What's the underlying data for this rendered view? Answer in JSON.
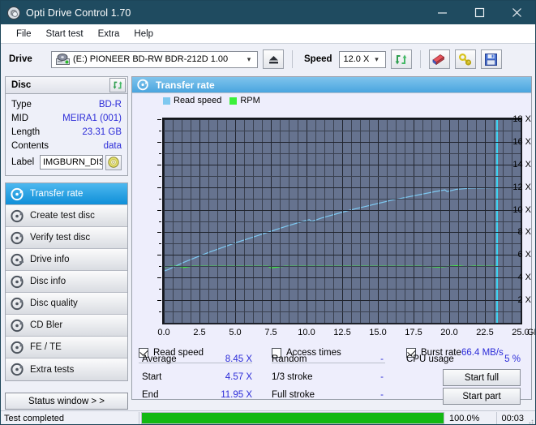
{
  "window": {
    "title": "Opti Drive Control 1.70",
    "icon": "disc-icon",
    "minimize": "–",
    "maximize": "□",
    "close": "✕"
  },
  "menu": [
    {
      "label": "File"
    },
    {
      "label": "Start test"
    },
    {
      "label": "Extra"
    },
    {
      "label": "Help"
    }
  ],
  "toolbar": {
    "drive_label": "Drive",
    "drive_value": "(E:)  PIONEER BD-RW  BDR-212D 1.00",
    "eject_icon": "eject-icon",
    "speed_label": "Speed",
    "speed_value": "12.0 X",
    "refresh_icon": "refresh-icon",
    "erase_icon": "eraser-icon",
    "key_icon": "key-icon",
    "save_icon": "save-icon"
  },
  "disc": {
    "header": "Disc",
    "refresh_icon": "refresh-icon",
    "rows": [
      {
        "key": "Type",
        "value": "BD-R"
      },
      {
        "key": "MID",
        "value": "MEIRA1 (001)"
      },
      {
        "key": "Length",
        "value": "23.31 GB"
      },
      {
        "key": "Contents",
        "value": "data"
      }
    ],
    "label_key": "Label",
    "label_value": "IMGBURN_DIS",
    "label_btn_icon": "disc-icon"
  },
  "nav": [
    {
      "label": "Transfer rate",
      "icon": "disc-test-icon",
      "active": true
    },
    {
      "label": "Create test disc",
      "icon": "disc-test-icon",
      "active": false
    },
    {
      "label": "Verify test disc",
      "icon": "disc-test-icon",
      "active": false
    },
    {
      "label": "Drive info",
      "icon": "disc-test-icon",
      "active": false
    },
    {
      "label": "Disc info",
      "icon": "disc-test-icon",
      "active": false
    },
    {
      "label": "Disc quality",
      "icon": "disc-test-icon",
      "active": false
    },
    {
      "label": "CD Bler",
      "icon": "disc-test-icon",
      "active": false
    },
    {
      "label": "FE / TE",
      "icon": "disc-test-icon",
      "active": false
    },
    {
      "label": "Extra tests",
      "icon": "disc-test-icon",
      "active": false
    }
  ],
  "status_window_button": "Status window > >",
  "main": {
    "title": "Transfer rate",
    "icon": "disc-test-icon"
  },
  "options": {
    "read_speed": {
      "label": "Read speed",
      "checked": true
    },
    "access_times": {
      "label": "Access times",
      "checked": false
    },
    "burst_rate": {
      "label": "Burst rate",
      "checked": true
    },
    "burst_value": "66.4 MB/s"
  },
  "stats": {
    "col1": [
      {
        "key": "Average",
        "value": "8.45 X"
      },
      {
        "key": "Start",
        "value": "4.57 X"
      },
      {
        "key": "End",
        "value": "11.95 X"
      }
    ],
    "col2": [
      {
        "key": "Random",
        "value": "-"
      },
      {
        "key": "1/3 stroke",
        "value": "-"
      },
      {
        "key": "Full stroke",
        "value": "-"
      }
    ],
    "col3": [
      {
        "key": "CPU usage",
        "value": "5 %"
      }
    ],
    "start_full": "Start full",
    "start_part": "Start part"
  },
  "statusbar": {
    "text": "Test completed",
    "percent": "100.0%",
    "time": "00:03",
    "progress": 100,
    "progress_color": "#12b812"
  },
  "chart_data": {
    "type": "line",
    "title": "Transfer rate",
    "xlabel": "GB",
    "ylabel": "X",
    "xlim": [
      0,
      25
    ],
    "ylim": [
      0,
      18
    ],
    "xticks": [
      "0.0",
      "2.5",
      "5.0",
      "7.5",
      "10.0",
      "12.5",
      "15.0",
      "17.5",
      "20.0",
      "22.5",
      "25.0"
    ],
    "xtick_values": [
      0,
      2.5,
      5,
      7.5,
      10,
      12.5,
      15,
      17.5,
      20,
      22.5,
      25
    ],
    "yticks": [
      "2 X",
      "4 X",
      "6 X",
      "8 X",
      "10 X",
      "12 X",
      "14 X",
      "16 X",
      "18 X"
    ],
    "ytick_values": [
      2,
      4,
      6,
      8,
      10,
      12,
      14,
      16,
      18
    ],
    "grid": true,
    "legend_position": "top-left",
    "marker_x": 23.31,
    "series": [
      {
        "name": "Read speed",
        "color": "#7ec8f0",
        "x": [
          0.0,
          0.3,
          0.8,
          1.5,
          2.3,
          3.2,
          4.2,
          5.2,
          6.3,
          7.4,
          8.5,
          9.6,
          10.2,
          10.35,
          11.0,
          12.0,
          13.0,
          14.0,
          15.0,
          16.0,
          17.0,
          18.0,
          19.0,
          19.7,
          19.85,
          20.5,
          21.5,
          22.4,
          23.31
        ],
        "y": [
          4.57,
          4.7,
          5.0,
          5.4,
          5.8,
          6.25,
          6.7,
          7.15,
          7.6,
          8.05,
          8.5,
          8.92,
          9.12,
          8.95,
          9.25,
          9.6,
          9.95,
          10.25,
          10.55,
          10.85,
          11.1,
          11.35,
          11.6,
          11.75,
          11.6,
          11.8,
          11.9,
          11.92,
          11.95
        ]
      },
      {
        "name": "RPM",
        "color": "#3bf03b",
        "x": [
          0.0,
          0.5,
          1.1,
          1.3,
          2.0,
          4.0,
          6.0,
          7.3,
          7.5,
          8.5,
          10.0,
          12.0,
          14.0,
          16.0,
          18.0,
          19.3,
          20.0,
          20.6,
          21.2,
          21.8,
          22.4,
          23.31
        ],
        "y": [
          4.95,
          5.0,
          5.0,
          4.88,
          5.0,
          5.0,
          5.0,
          5.0,
          4.86,
          5.0,
          5.0,
          5.0,
          5.0,
          5.0,
          5.0,
          4.93,
          5.0,
          5.05,
          4.97,
          5.02,
          5.0,
          5.0
        ]
      }
    ]
  }
}
